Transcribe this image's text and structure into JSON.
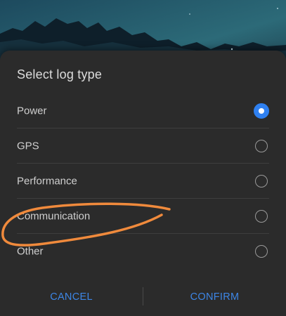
{
  "dialog": {
    "title": "Select log type",
    "options": [
      {
        "label": "Power",
        "selected": true
      },
      {
        "label": "GPS",
        "selected": false
      },
      {
        "label": "Performance",
        "selected": false
      },
      {
        "label": "Communication",
        "selected": false
      },
      {
        "label": "Other",
        "selected": false
      }
    ],
    "cancel_label": "CANCEL",
    "confirm_label": "CONFIRM"
  },
  "colors": {
    "accent": "#2f80f0",
    "button_text": "#3d86e6",
    "dialog_bg": "#2b2b2b",
    "annotation": "#f08a3c"
  }
}
